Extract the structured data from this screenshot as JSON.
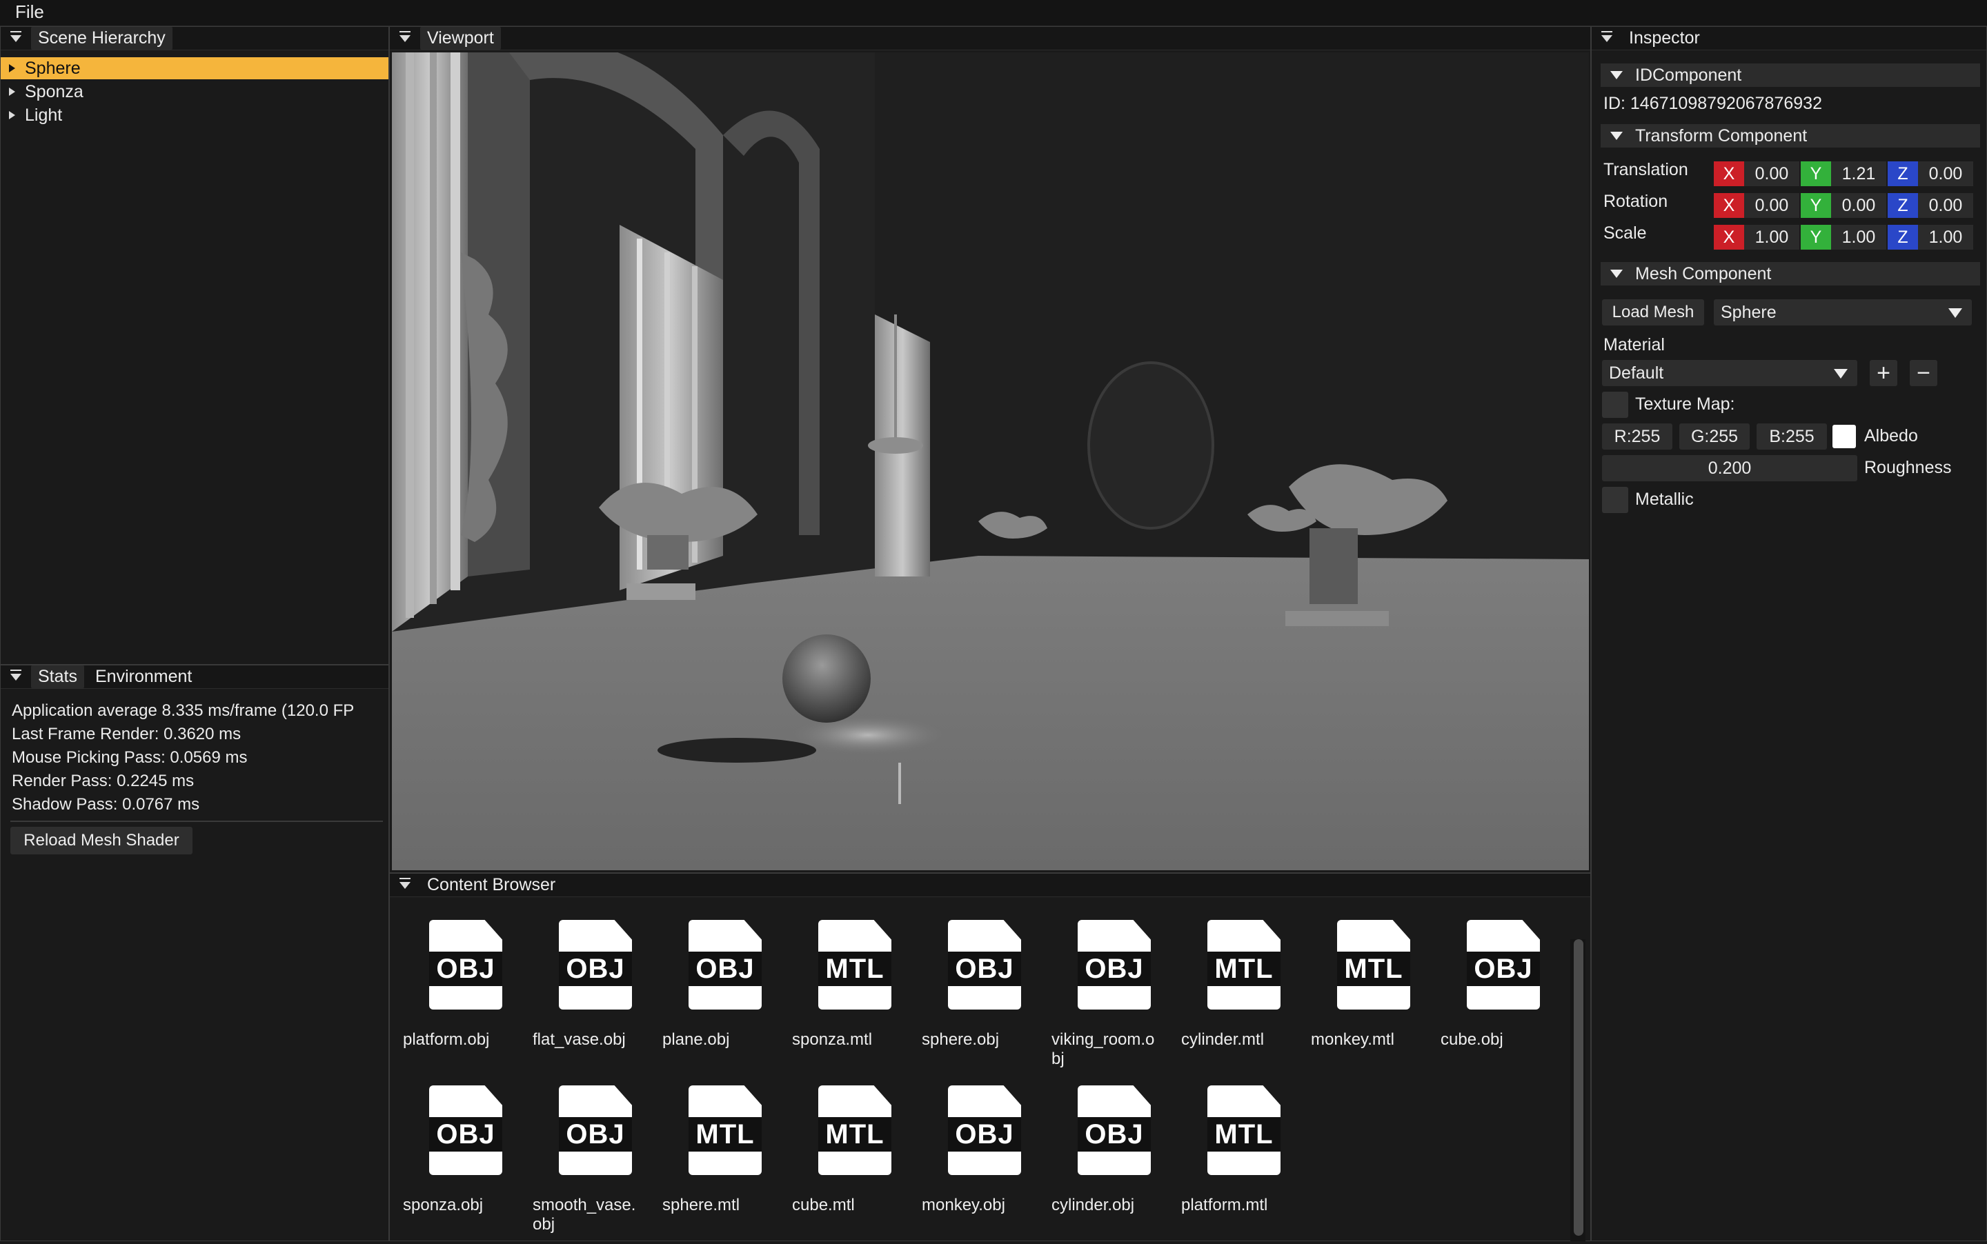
{
  "menubar": {
    "file": "File"
  },
  "scene_hierarchy": {
    "tab": "Scene Hierarchy",
    "items": [
      {
        "label": "Sphere",
        "selected": true
      },
      {
        "label": "Sponza",
        "selected": false
      },
      {
        "label": "Light",
        "selected": false
      }
    ]
  },
  "stats": {
    "tabs": [
      "Stats",
      "Environment"
    ],
    "lines": [
      "Application average 8.335 ms/frame (120.0 FP",
      "Last Frame Render: 0.3620 ms",
      "Mouse Picking Pass: 0.0569 ms",
      "Render Pass: 0.2245 ms",
      "Shadow Pass: 0.0767 ms"
    ],
    "reload_button": "Reload Mesh Shader"
  },
  "viewport": {
    "tab": "Viewport"
  },
  "content_browser": {
    "tab": "Content Browser",
    "files": [
      {
        "type": "OBJ",
        "name": "platform.obj"
      },
      {
        "type": "OBJ",
        "name": "flat_vase.obj"
      },
      {
        "type": "OBJ",
        "name": "plane.obj"
      },
      {
        "type": "MTL",
        "name": "sponza.mtl"
      },
      {
        "type": "OBJ",
        "name": "sphere.obj"
      },
      {
        "type": "OBJ",
        "name": "viking_room.obj"
      },
      {
        "type": "MTL",
        "name": "cylinder.mtl"
      },
      {
        "type": "MTL",
        "name": "monkey.mtl"
      },
      {
        "type": "OBJ",
        "name": "cube.obj"
      },
      {
        "type": "OBJ",
        "name": "sponza.obj"
      },
      {
        "type": "OBJ",
        "name": "smooth_vase.obj"
      },
      {
        "type": "MTL",
        "name": "sphere.mtl"
      },
      {
        "type": "MTL",
        "name": "cube.mtl"
      },
      {
        "type": "OBJ",
        "name": "monkey.obj"
      },
      {
        "type": "OBJ",
        "name": "cylinder.obj"
      },
      {
        "type": "MTL",
        "name": "platform.mtl"
      }
    ]
  },
  "inspector": {
    "tab": "Inspector",
    "id_component": {
      "header": "IDComponent",
      "id_text": "ID: 14671098792067876932"
    },
    "transform": {
      "header": "Transform Component",
      "axis_labels": {
        "x": "X",
        "y": "Y",
        "z": "Z"
      },
      "rows": [
        {
          "label": "Translation",
          "x": "0.00",
          "y": "1.21",
          "z": "0.00"
        },
        {
          "label": "Rotation",
          "x": "0.00",
          "y": "0.00",
          "z": "0.00"
        },
        {
          "label": "Scale",
          "x": "1.00",
          "y": "1.00",
          "z": "1.00"
        }
      ]
    },
    "mesh": {
      "header": "Mesh Component",
      "load_button": "Load Mesh",
      "mesh_select": "Sphere",
      "material_label": "Material",
      "material_select": "Default",
      "add_symbol": "+",
      "remove_symbol": "−",
      "texture_map_label": "Texture Map:",
      "r": "R:255",
      "g": "G:255",
      "b": "B:255",
      "albedo_label": "Albedo",
      "albedo_color": "#ffffff",
      "roughness_value": "0.200",
      "roughness_label": "Roughness",
      "metallic_label": "Metallic"
    }
  },
  "colors": {
    "selection": "#f5b53c",
    "axis_x": "#cc1f27",
    "axis_y": "#33b13b",
    "axis_z": "#2a47c8"
  }
}
